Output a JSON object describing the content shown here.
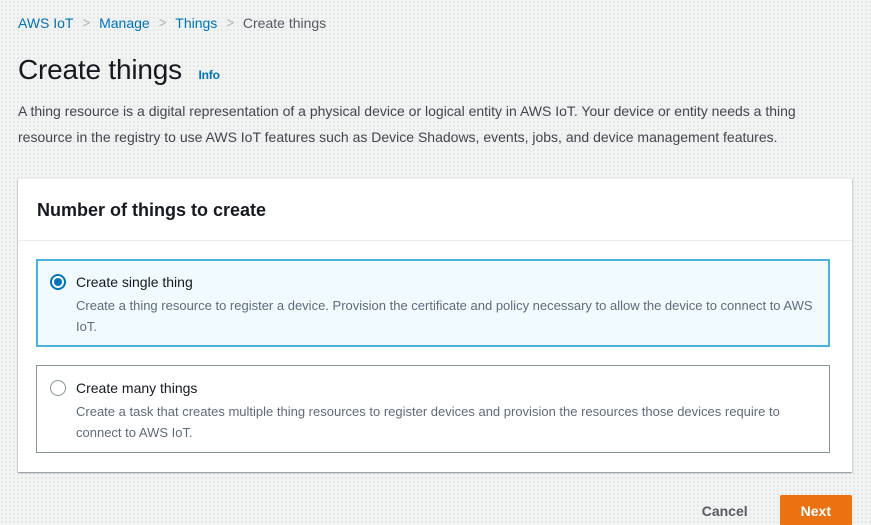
{
  "breadcrumb": {
    "separator": ">",
    "items": [
      {
        "label": "AWS IoT"
      },
      {
        "label": "Manage"
      },
      {
        "label": "Things"
      },
      {
        "label": "Create things"
      }
    ]
  },
  "header": {
    "title": "Create things",
    "info_label": "Info",
    "description": "A thing resource is a digital representation of a physical device or logical entity in AWS IoT. Your device or entity needs a thing resource in the registry to use AWS IoT features such as Device Shadows, events, jobs, and device management features."
  },
  "panel": {
    "title": "Number of things to create",
    "options": [
      {
        "label": "Create single thing",
        "description": "Create a thing resource to register a device. Provision the certificate and policy necessary to allow the device to connect to AWS IoT.",
        "selected": true
      },
      {
        "label": "Create many things",
        "description": "Create a task that creates multiple thing resources to register devices and provision the resources those devices require to connect to AWS IoT.",
        "selected": false
      }
    ]
  },
  "footer": {
    "cancel_label": "Cancel",
    "next_label": "Next"
  },
  "colors": {
    "link_blue": "#0073bb",
    "radio_blue": "#0073bb",
    "accent_orange": "#ec7211",
    "selected_border": "#4db2d9",
    "selected_bg": "#f1faff",
    "page_bg": "#f2f3f3",
    "text_dark": "#16191f",
    "text_secondary": "#5f6b7a"
  }
}
